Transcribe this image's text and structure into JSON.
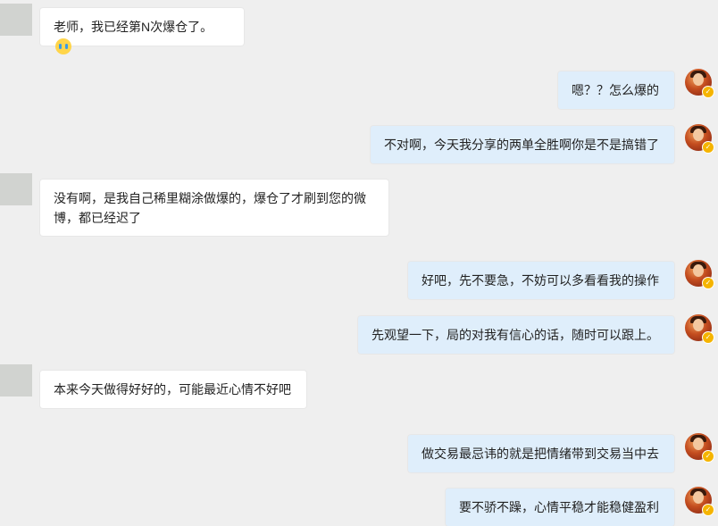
{
  "chat": {
    "messages": [
      {
        "side": "left",
        "text": "老师，我已经第N次爆仓了。",
        "emoji": "crying-face-emoji"
      },
      {
        "side": "right",
        "text": "嗯？？怎么爆的"
      },
      {
        "side": "right",
        "text": "不对啊，今天我分享的两单全胜啊你是不是搞错了"
      },
      {
        "side": "left",
        "text": "没有啊，是我自己稀里糊涂做爆的，爆仓了才刷到您的微",
        "text2": "博，都已经迟了"
      },
      {
        "side": "right",
        "text": "好吧，先不要急，不妨可以多看看我的操作"
      },
      {
        "side": "right",
        "text": "先观望一下，局的对我有信心的话，随时可以跟上。"
      },
      {
        "side": "left",
        "text": "本来今天做得好好的，可能最近心情不好吧"
      },
      {
        "side": "right",
        "text": "做交易最忌讳的就是把情绪带到交易当中去"
      },
      {
        "side": "right",
        "text": "要不骄不躁，心情平稳才能稳健盈利"
      }
    ]
  },
  "colors": {
    "background": "#efefef",
    "bubble_left": "#ffffff",
    "bubble_right": "#dfeefb",
    "avatar_placeholder": "#d1d3d0",
    "badge": "#f5b400"
  }
}
